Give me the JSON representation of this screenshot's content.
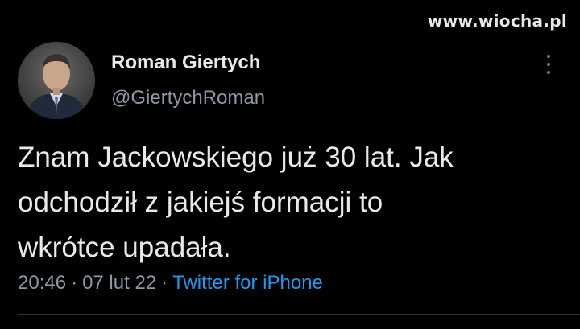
{
  "watermark": "www.wiocha.pl",
  "author": {
    "display_name": "Roman Giertych",
    "handle": "@GiertychRoman",
    "avatar": "avatar-photo"
  },
  "tweet": {
    "lines": [
      "Znam Jackowskiego już 30 lat. Jak",
      "odchodził z jakiejś formacji to",
      "wkrótce upadała."
    ]
  },
  "meta": {
    "time": "20:46",
    "date": "07 lut 22",
    "separator": "·",
    "source": "Twitter for iPhone"
  },
  "icons": {
    "more": "more-vertical-icon"
  },
  "colors": {
    "background": "#000000",
    "text": "#e7e9ea",
    "secondary_text": "#8b98a5",
    "link": "#1d9bf0"
  }
}
